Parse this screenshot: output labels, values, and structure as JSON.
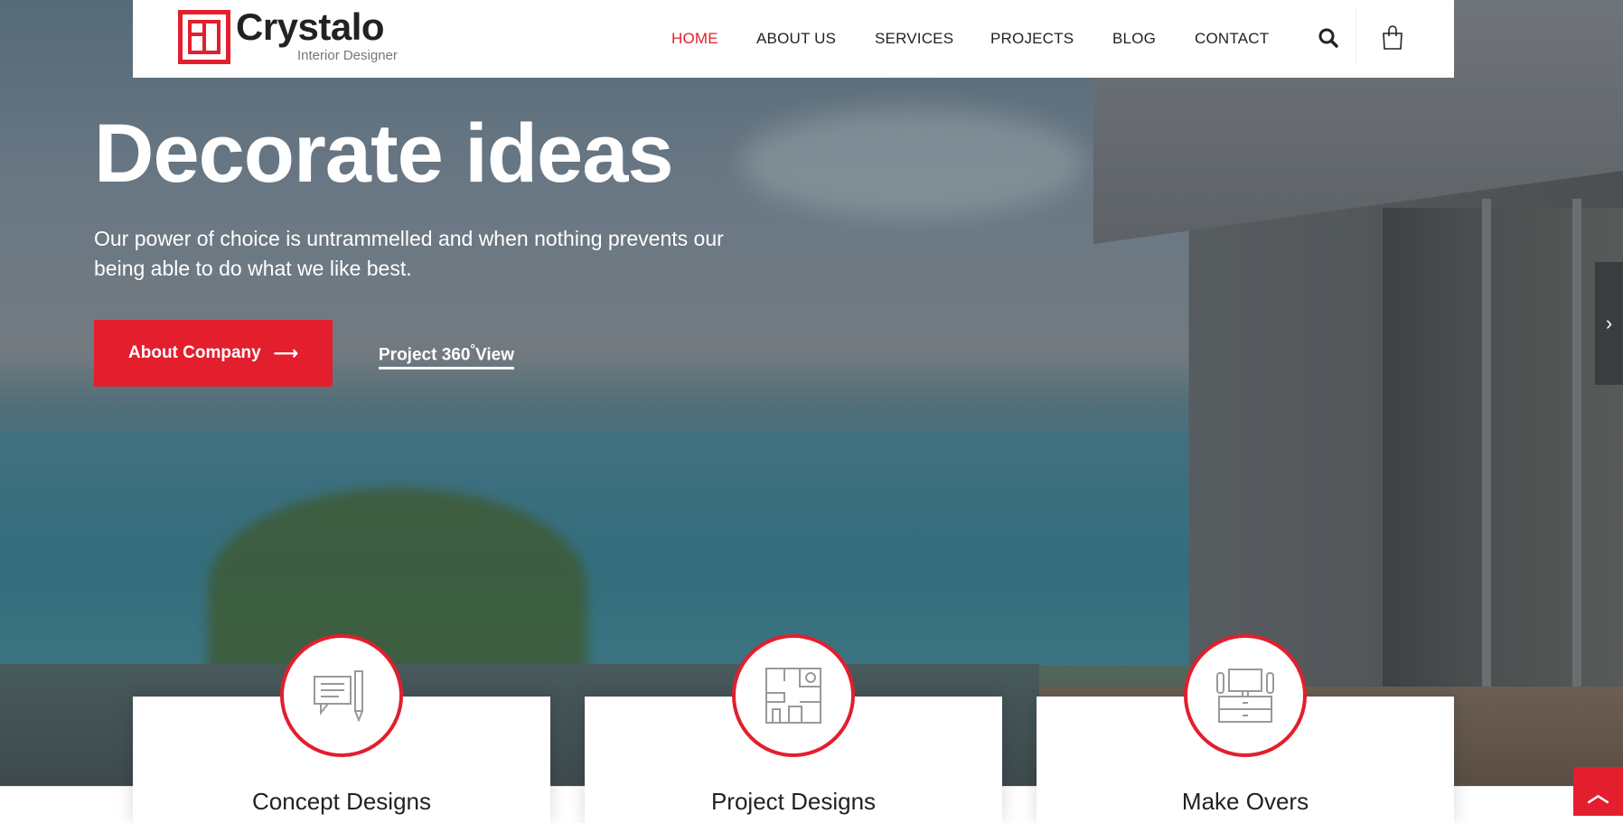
{
  "brand": {
    "name": "Crystalo",
    "tagline": "Interior Designer",
    "accent": "#e31e2d"
  },
  "nav": {
    "items": [
      {
        "label": "HOME",
        "active": true
      },
      {
        "label": "ABOUT US"
      },
      {
        "label": "SERVICES"
      },
      {
        "label": "PROJECTS"
      },
      {
        "label": "BLOG"
      },
      {
        "label": "CONTACT"
      }
    ],
    "icons": [
      "search-icon",
      "shopping-bag-icon"
    ]
  },
  "hero": {
    "title": "Decorate ideas",
    "text": "Our power of choice is untrammelled and when nothing prevents our being able to do what we like best.",
    "primary_button": "About Company",
    "secondary_link": "Project 360",
    "secondary_link_sup": "°",
    "secondary_link_suffix": "View"
  },
  "cards": [
    {
      "title": "Concept Designs",
      "icon": "concept-design-icon"
    },
    {
      "title": "Project Designs",
      "icon": "floor-plan-icon"
    },
    {
      "title": "Make Overs",
      "icon": "tv-cabinet-icon"
    }
  ]
}
